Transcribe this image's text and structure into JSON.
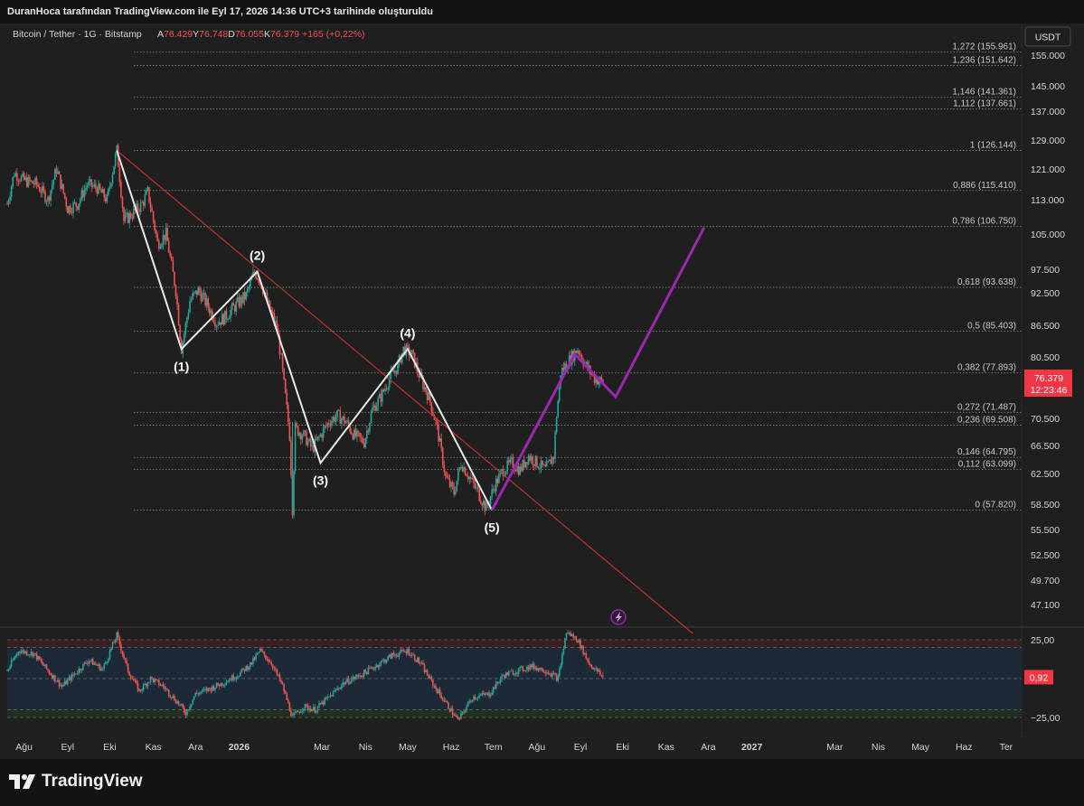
{
  "header": {
    "attribution": "DuranHoca tarafından TradingView.com ile Eyl 17, 2026 14:36 UTC+3 tarihinde oluşturuldu"
  },
  "symbol": {
    "name": "Bitcoin / Tether · 1G · Bitstamp",
    "o_label": "A",
    "o_value": "76.429",
    "h_label": "Y",
    "h_value": "76.748",
    "l_label": "D",
    "l_value": "76.055",
    "c_label": "K",
    "c_value": "76.379",
    "change": "+165 (+0,22%)"
  },
  "currency_button": "USDT",
  "price_tag": {
    "value": "76.379",
    "countdown": "12:23:46"
  },
  "colors": {
    "up": "#26a69a",
    "down": "#ef5350",
    "wave_white": "#e8e8e8",
    "wave_purple": "#9c27b0",
    "trendline": "#d32f2f"
  },
  "footer": {
    "brand": "TradingView"
  },
  "chart_data": [
    {
      "type": "candlestick",
      "title": "Bitcoin / Tether · 1G · Bitstamp",
      "y_ticks": [
        155.0,
        145.0,
        137.0,
        129.0,
        121.0,
        113.0,
        105.0,
        97.5,
        92.5,
        86.5,
        80.5,
        70.5,
        66.5,
        62.5,
        58.5,
        55.5,
        52.5,
        49.7,
        47.1
      ],
      "y_tick_labels": [
        "155.000",
        "145.000",
        "137.000",
        "129.000",
        "121.000",
        "113.000",
        "105.000",
        "97.500",
        "92.500",
        "86.500",
        "80.500",
        "70.500",
        "66.500",
        "62.500",
        "58.500",
        "55.500",
        "52.500",
        "49.700",
        "47.100"
      ],
      "x_ticks": [
        {
          "label": "Ağu",
          "date": "2025-08-01"
        },
        {
          "label": "Eyl",
          "date": "2025-09-01"
        },
        {
          "label": "Eki",
          "date": "2025-10-01"
        },
        {
          "label": "Kas",
          "date": "2025-11-01"
        },
        {
          "label": "Ara",
          "date": "2025-12-01"
        },
        {
          "label": "2026",
          "date": "2026-01-01"
        },
        {
          "label": "Mar",
          "date": "2026-03-01"
        },
        {
          "label": "Nis",
          "date": "2026-04-01"
        },
        {
          "label": "May",
          "date": "2026-05-01"
        },
        {
          "label": "Haz",
          "date": "2026-06-01"
        },
        {
          "label": "Tem",
          "date": "2026-07-01"
        },
        {
          "label": "Ağu",
          "date": "2026-08-01"
        },
        {
          "label": "Eyl",
          "date": "2026-09-01"
        },
        {
          "label": "Eki",
          "date": "2026-10-01"
        },
        {
          "label": "Kas",
          "date": "2026-11-01"
        },
        {
          "label": "Ara",
          "date": "2026-12-01"
        },
        {
          "label": "2027",
          "date": "2027-01-01"
        },
        {
          "label": "Mar",
          "date": "2027-03-01"
        },
        {
          "label": "Nis",
          "date": "2027-04-01"
        },
        {
          "label": "May",
          "date": "2027-05-01"
        },
        {
          "label": "Haz",
          "date": "2027-06-01"
        },
        {
          "label": "Ter",
          "date": "2027-07-01"
        }
      ],
      "x_range": [
        "2025-07-20",
        "2027-07-12"
      ],
      "ohlc_path": [
        [
          "2025-07-20",
          112
        ],
        [
          "2025-07-25",
          120
        ],
        [
          "2025-08-01",
          118
        ],
        [
          "2025-08-10",
          117
        ],
        [
          "2025-08-18",
          113
        ],
        [
          "2025-08-24",
          121
        ],
        [
          "2025-09-01",
          111
        ],
        [
          "2025-09-08",
          112
        ],
        [
          "2025-09-15",
          117
        ],
        [
          "2025-09-22",
          116
        ],
        [
          "2025-09-29",
          113
        ],
        [
          "2025-10-06",
          126.1
        ],
        [
          "2025-10-11",
          108
        ],
        [
          "2025-10-18",
          110
        ],
        [
          "2025-10-24",
          112
        ],
        [
          "2025-10-28",
          115
        ],
        [
          "2025-11-04",
          103
        ],
        [
          "2025-11-10",
          105
        ],
        [
          "2025-11-17",
          93
        ],
        [
          "2025-11-21",
          82
        ],
        [
          "2025-11-27",
          91
        ],
        [
          "2025-12-03",
          93
        ],
        [
          "2025-12-10",
          90
        ],
        [
          "2025-12-16",
          87
        ],
        [
          "2025-12-22",
          88
        ],
        [
          "2025-12-29",
          90
        ],
        [
          "2026-01-06",
          92
        ],
        [
          "2026-01-12",
          97
        ],
        [
          "2026-01-16",
          95
        ],
        [
          "2026-01-22",
          90
        ],
        [
          "2026-01-28",
          86
        ],
        [
          "2026-02-01",
          78
        ],
        [
          "2026-02-06",
          68
        ],
        [
          "2026-02-08",
          58
        ],
        [
          "2026-02-10",
          69
        ],
        [
          "2026-02-16",
          68
        ],
        [
          "2026-02-22",
          66
        ],
        [
          "2026-02-28",
          68
        ],
        [
          "2026-03-06",
          70
        ],
        [
          "2026-03-12",
          71
        ],
        [
          "2026-03-18",
          70
        ],
        [
          "2026-03-24",
          68
        ],
        [
          "2026-03-31",
          67
        ],
        [
          "2026-04-06",
          72
        ],
        [
          "2026-04-12",
          74
        ],
        [
          "2026-04-18",
          77
        ],
        [
          "2026-04-24",
          79
        ],
        [
          "2026-04-28",
          82
        ],
        [
          "2026-05-04",
          81
        ],
        [
          "2026-05-10",
          77
        ],
        [
          "2026-05-16",
          74
        ],
        [
          "2026-05-22",
          69
        ],
        [
          "2026-05-28",
          62
        ],
        [
          "2026-06-03",
          60
        ],
        [
          "2026-06-08",
          64
        ],
        [
          "2026-06-14",
          62
        ],
        [
          "2026-06-20",
          60
        ],
        [
          "2026-06-26",
          58
        ],
        [
          "2026-07-02",
          61
        ],
        [
          "2026-07-08",
          63
        ],
        [
          "2026-07-14",
          64
        ],
        [
          "2026-07-20",
          63
        ],
        [
          "2026-07-26",
          65
        ],
        [
          "2026-08-01",
          64
        ],
        [
          "2026-08-07",
          63
        ],
        [
          "2026-08-13",
          65
        ],
        [
          "2026-08-15",
          71
        ],
        [
          "2026-08-18",
          78
        ],
        [
          "2026-08-24",
          80
        ],
        [
          "2026-08-30",
          82
        ],
        [
          "2026-09-05",
          79
        ],
        [
          "2026-09-11",
          77
        ],
        [
          "2026-09-17",
          76.4
        ]
      ],
      "fibonacci": [
        {
          "ratio": "1,272",
          "price": 155.961,
          "label": "1,272 (155.961)"
        },
        {
          "ratio": "1,236",
          "price": 151.642,
          "label": "1,236 (151.642)"
        },
        {
          "ratio": "1,146",
          "price": 141.361,
          "label": "1,146 (141.361)"
        },
        {
          "ratio": "1,112",
          "price": 137.661,
          "label": "1,112 (137.661)"
        },
        {
          "ratio": "1",
          "price": 126.144,
          "label": "1 (126.144)"
        },
        {
          "ratio": "0,886",
          "price": 115.41,
          "label": "0,886 (115.410)"
        },
        {
          "ratio": "0,786",
          "price": 106.75,
          "label": "0,786 (106.750)"
        },
        {
          "ratio": "0,618",
          "price": 93.638,
          "label": "0,618 (93.638)"
        },
        {
          "ratio": "0,5",
          "price": 85.403,
          "label": "0,5 (85.403)"
        },
        {
          "ratio": "0,382",
          "price": 77.893,
          "label": "0,382 (77.893)"
        },
        {
          "ratio": "0,272",
          "price": 71.487,
          "label": "0,272 (71.487)"
        },
        {
          "ratio": "0,236",
          "price": 69.508,
          "label": "0,236 (69.508)"
        },
        {
          "ratio": "0,146",
          "price": 64.795,
          "label": "0,146 (64.795)"
        },
        {
          "ratio": "0,112",
          "price": 63.099,
          "label": "0,112 (63.099)"
        },
        {
          "ratio": "0",
          "price": 57.82,
          "label": "0 (57.820)"
        }
      ],
      "elliott_waves": [
        {
          "label": "",
          "date": "2025-10-06",
          "price": 126.1
        },
        {
          "label": "(1)",
          "date": "2025-11-21",
          "price": 82
        },
        {
          "label": "(2)",
          "date": "2026-01-14",
          "price": 97
        },
        {
          "label": "(3)",
          "date": "2026-02-28",
          "price": 64
        },
        {
          "label": "(4)",
          "date": "2026-05-01",
          "price": 82
        },
        {
          "label": "(5)",
          "date": "2026-06-30",
          "price": 57.8
        }
      ],
      "projection": [
        {
          "date": "2026-06-30",
          "price": 57.8
        },
        {
          "date": "2026-08-28",
          "price": 81
        },
        {
          "date": "2026-09-26",
          "price": 74
        },
        {
          "date": "2026-11-28",
          "price": 106.5
        }
      ],
      "trendline": [
        {
          "date": "2025-10-06",
          "price": 126.1
        },
        {
          "date": "2026-11-20",
          "price": 44
        }
      ],
      "last_price": 76.379
    },
    {
      "type": "line",
      "panel": "oscillator",
      "y_ticks": [
        25,
        -25
      ],
      "y_tick_labels": [
        "25,00",
        "−25,00"
      ],
      "band_upper": 25,
      "band_lower": -25,
      "band_inner_upper": 20,
      "band_inner_lower": -20,
      "y_range": [
        -32,
        32
      ],
      "last_value": 0.92,
      "last_value_label": "0,92",
      "series": [
        [
          "2025-07-20",
          5
        ],
        [
          "2025-07-28",
          18
        ],
        [
          "2025-08-08",
          16
        ],
        [
          "2025-08-18",
          5
        ],
        [
          "2025-08-28",
          -5
        ],
        [
          "2025-09-06",
          3
        ],
        [
          "2025-09-16",
          12
        ],
        [
          "2025-09-26",
          6
        ],
        [
          "2025-10-06",
          28
        ],
        [
          "2025-10-14",
          5
        ],
        [
          "2025-10-22",
          -8
        ],
        [
          "2025-10-30",
          0
        ],
        [
          "2025-11-08",
          -5
        ],
        [
          "2025-11-18",
          -15
        ],
        [
          "2025-11-24",
          -22
        ],
        [
          "2025-12-01",
          -10
        ],
        [
          "2025-12-10",
          -7
        ],
        [
          "2025-12-20",
          -3
        ],
        [
          "2026-01-01",
          3
        ],
        [
          "2026-01-10",
          10
        ],
        [
          "2026-01-16",
          18
        ],
        [
          "2026-01-24",
          10
        ],
        [
          "2026-02-01",
          -5
        ],
        [
          "2026-02-08",
          -25
        ],
        [
          "2026-02-16",
          -18
        ],
        [
          "2026-02-24",
          -20
        ],
        [
          "2026-03-06",
          -12
        ],
        [
          "2026-03-16",
          -3
        ],
        [
          "2026-03-28",
          2
        ],
        [
          "2026-04-08",
          8
        ],
        [
          "2026-04-20",
          15
        ],
        [
          "2026-05-01",
          18
        ],
        [
          "2026-05-10",
          10
        ],
        [
          "2026-05-20",
          -5
        ],
        [
          "2026-05-30",
          -18
        ],
        [
          "2026-06-06",
          -27
        ],
        [
          "2026-06-16",
          -12
        ],
        [
          "2026-06-28",
          -10
        ],
        [
          "2026-07-08",
          2
        ],
        [
          "2026-07-18",
          5
        ],
        [
          "2026-07-28",
          8
        ],
        [
          "2026-08-08",
          5
        ],
        [
          "2026-08-16",
          0
        ],
        [
          "2026-08-22",
          30
        ],
        [
          "2026-08-30",
          25
        ],
        [
          "2026-09-07",
          10
        ],
        [
          "2026-09-17",
          0.92
        ]
      ]
    }
  ]
}
